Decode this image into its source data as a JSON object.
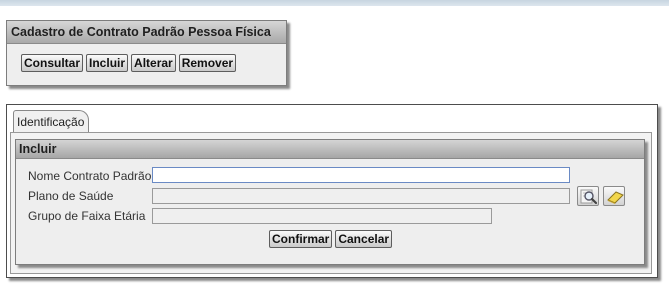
{
  "panel_consulta": {
    "title": "Cadastro de Contrato Padrão Pessoa Física",
    "buttons": {
      "consultar": "Consultar",
      "incluir": "Incluir",
      "alterar": "Alterar",
      "remover": "Remover"
    }
  },
  "tabs": [
    {
      "label": "Identificação"
    }
  ],
  "form": {
    "section_title": "Incluir",
    "fields": {
      "nome_contrato": {
        "label": "Nome Contrato Padrão",
        "value": ""
      },
      "plano_saude": {
        "label": "Plano de Saúde",
        "value": ""
      },
      "grupo_faixa": {
        "label": "Grupo de Faixa Etária",
        "value": ""
      }
    },
    "icons": {
      "search": "search-icon",
      "clear": "eraser-icon"
    },
    "actions": {
      "confirmar": "Confirmar",
      "cancelar": "Cancelar"
    }
  }
}
